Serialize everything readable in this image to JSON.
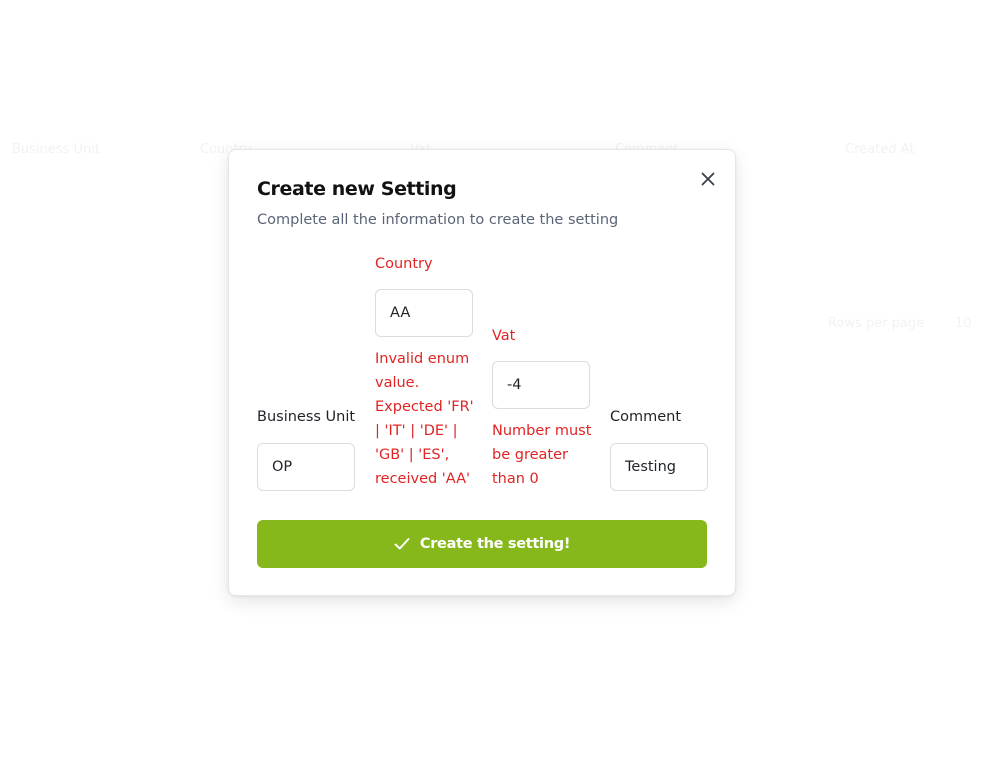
{
  "background": {
    "faint_labels": [
      "Business Unit",
      "Country",
      "Vat",
      "Comment",
      "Created At",
      "Rows per page",
      "10"
    ]
  },
  "modal": {
    "title": "Create new Setting",
    "subtitle": "Complete all the information to create the setting",
    "close_icon": "close-icon",
    "fields": {
      "business_unit": {
        "label": "Business Unit",
        "value": "OP"
      },
      "country": {
        "label": "Country",
        "value": "AA",
        "error": "Invalid enum value. Expected 'FR' | 'IT' | 'DE' | 'GB' | 'ES', received 'AA'"
      },
      "vat": {
        "label": "Vat",
        "value": "-4",
        "error": "Number must be greater than 0"
      },
      "comment": {
        "label": "Comment",
        "value": "Testing"
      }
    },
    "submit": {
      "label": "Create the setting!",
      "icon": "check-icon"
    }
  },
  "colors": {
    "accent": "#86b81c",
    "error": "#e02424",
    "title": "#101214",
    "subtitle": "#5b6577"
  }
}
